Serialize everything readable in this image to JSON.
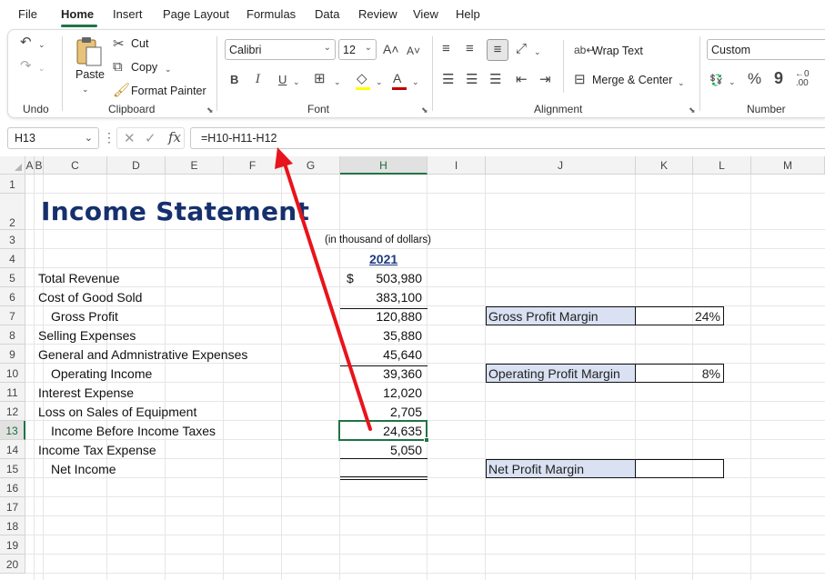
{
  "ribbon_tabs": [
    "File",
    "Home",
    "Insert",
    "Page Layout",
    "Formulas",
    "Data",
    "Review",
    "View",
    "Help"
  ],
  "groups": {
    "undo": "Undo",
    "clipboard": "Clipboard",
    "font": "Font",
    "alignment": "Alignment",
    "number": "Number"
  },
  "clipboard": {
    "paste": "Paste",
    "cut": "Cut",
    "copy": "Copy",
    "format_painter": "Format Painter"
  },
  "font": {
    "name": "Calibri",
    "size": "12",
    "bold": "B",
    "italic": "I",
    "underline": "U"
  },
  "alignment": {
    "wrap_text": "Wrap Text",
    "merge_center": "Merge & Center"
  },
  "number": {
    "format": "Custom",
    "percent": "%",
    "comma": "9"
  },
  "formula_bar": {
    "name_box": "H13",
    "formula": "=H10-H11-H12",
    "fx": "fx"
  },
  "columns": [
    "A",
    "B",
    "C",
    "D",
    "E",
    "F",
    "G",
    "H",
    "I",
    "J",
    "K",
    "L",
    "M"
  ],
  "rows": [
    "1",
    "2",
    "3",
    "4",
    "5",
    "6",
    "7",
    "8",
    "9",
    "10",
    "11",
    "12",
    "13",
    "14",
    "15",
    "16",
    "17",
    "18",
    "19",
    "20"
  ],
  "sheet": {
    "title": "Income Statement",
    "unit_note": "(in thousand of dollars)",
    "year": "2021",
    "currency_symbol": "$",
    "lines": [
      {
        "label": "Total Revenue",
        "value": "503,980"
      },
      {
        "label": "Cost of Good Sold",
        "value": "383,100"
      },
      {
        "label": "Gross Profit",
        "value": "120,880"
      },
      {
        "label": "Selling Expenses",
        "value": "35,880"
      },
      {
        "label": "General and Admnistrative Expenses",
        "value": "45,640"
      },
      {
        "label": "Operating Income",
        "value": "39,360"
      },
      {
        "label": "Interest Expense",
        "value": "12,020"
      },
      {
        "label": "Loss on Sales of Equipment",
        "value": "2,705"
      },
      {
        "label": "Income Before Income Taxes",
        "value": "24,635"
      },
      {
        "label": "Income Tax Expense",
        "value": "5,050"
      },
      {
        "label": "Net Income",
        "value": ""
      }
    ],
    "ratios": [
      {
        "label": "Gross Profit Margin",
        "value": "24%"
      },
      {
        "label": "Operating Profit Margin",
        "value": "8%"
      },
      {
        "label": "Net Profit Margin",
        "value": ""
      }
    ]
  }
}
